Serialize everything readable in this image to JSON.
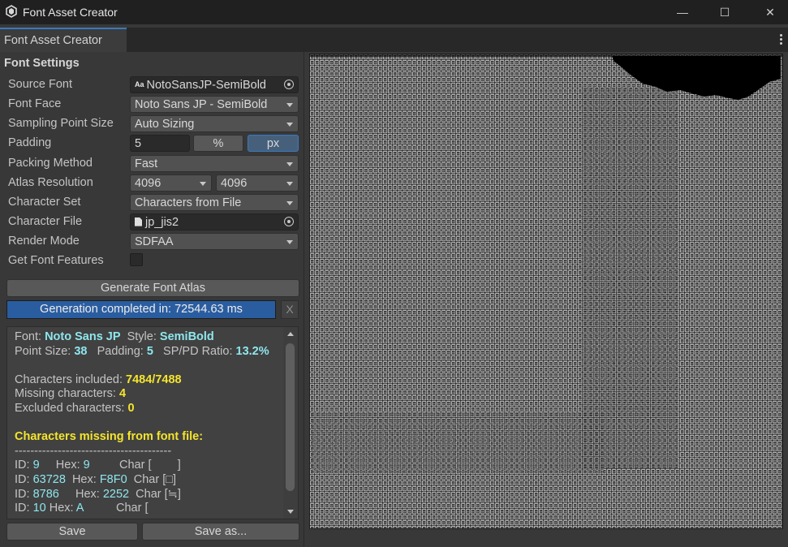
{
  "window": {
    "title": "Font Asset Creator",
    "controls": {
      "minimize": "—",
      "maximize": "☐",
      "close": "✕"
    }
  },
  "tab": {
    "label": "Font Asset Creator"
  },
  "settings": {
    "section_title": "Font Settings",
    "source_font": {
      "label": "Source Font",
      "value": "NotoSansJP-SemiBold",
      "type_badge": "Aa"
    },
    "font_face": {
      "label": "Font Face",
      "value": "Noto Sans JP - SemiBold"
    },
    "sampling_point_size": {
      "label": "Sampling Point Size",
      "value": "Auto Sizing"
    },
    "padding": {
      "label": "Padding",
      "value": "5",
      "unit_percent": "%",
      "unit_px": "px",
      "selected_unit": "px"
    },
    "packing_method": {
      "label": "Packing Method",
      "value": "Fast"
    },
    "atlas_resolution": {
      "label": "Atlas Resolution",
      "width": "4096",
      "height": "4096"
    },
    "character_set": {
      "label": "Character Set",
      "value": "Characters from File"
    },
    "character_file": {
      "label": "Character File",
      "value": "jp_jis2"
    },
    "render_mode": {
      "label": "Render Mode",
      "value": "SDFAA"
    },
    "get_font_features": {
      "label": "Get Font Features",
      "checked": false
    }
  },
  "actions": {
    "generate_label": "Generate Font Atlas",
    "progress_text": "Generation completed in: 72544.63 ms",
    "progress_fraction": 1.0,
    "clear_label": "X",
    "save_label": "Save",
    "save_as_label": "Save as..."
  },
  "report": {
    "font_label": "Font:",
    "font_value": "Noto Sans JP",
    "style_label": "Style:",
    "style_value": "SemiBold",
    "point_size_label": "Point Size:",
    "point_size_value": "38",
    "padding_label": "Padding:",
    "padding_value": "5",
    "ratio_label": "SP/PD Ratio:",
    "ratio_value": "13.2%",
    "included_label": "Characters included:",
    "included_value": "7484/7488",
    "missing_label": "Missing characters:",
    "missing_value": "4",
    "excluded_label": "Excluded characters:",
    "excluded_value": "0",
    "missing_heading": "Characters missing from font file:",
    "separator": "----------------------------------------",
    "rows": [
      {
        "id_label": "ID:",
        "id": "9",
        "hex_label": "Hex:",
        "hex": "9",
        "char_label": "Char",
        "char": "[        ]"
      },
      {
        "id_label": "ID:",
        "id": "63728",
        "hex_label": "Hex:",
        "hex": "F8F0",
        "char_label": "Char",
        "char": "[□]"
      },
      {
        "id_label": "ID:",
        "id": "8786",
        "hex_label": "Hex:",
        "hex": "2252",
        "char_label": "Char",
        "char": "[≒]"
      },
      {
        "id_label": "ID:",
        "id": "10",
        "hex_label": "Hex:",
        "hex": "A",
        "char_label": "Char",
        "char": "["
      }
    ]
  },
  "colors": {
    "accent": "#3a79bb",
    "progress": "#2a5da0",
    "report_cyan": "#8fe6ee",
    "report_yellow": "#f5e52c",
    "panel": "#383838"
  }
}
